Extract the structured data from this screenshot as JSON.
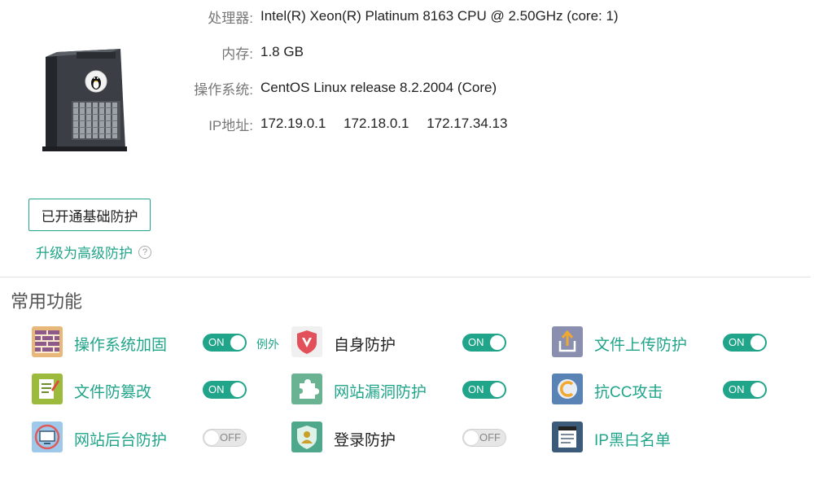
{
  "system_info": {
    "cpu_label": "处理器:",
    "cpu_value": "Intel(R) Xeon(R) Platinum 8163 CPU @ 2.50GHz (core: 1)",
    "memory_label": "内存:",
    "memory_value": "1.8 GB",
    "os_label": "操作系统:",
    "os_value": "CentOS Linux release 8.2.2004 (Core)",
    "ip_label": "IP地址:",
    "ips": [
      "172.19.0.1",
      "172.18.0.1",
      "172.17.34.13"
    ]
  },
  "protection": {
    "basic_button": "已开通基础防护",
    "upgrade_link": "升级为高级防护",
    "help_icon": "?"
  },
  "features": {
    "title": "常用功能",
    "on_text": "ON",
    "off_text": "OFF",
    "exception_link": "例外",
    "items": [
      {
        "label": "操作系统加固",
        "state": "on",
        "icon": "brick-wall-icon"
      },
      {
        "label": "自身防护",
        "state": "on",
        "icon": "shield-v-icon"
      },
      {
        "label": "文件上传防护",
        "state": "on",
        "icon": "upload-icon"
      },
      {
        "label": "文件防篡改",
        "state": "on",
        "icon": "file-edit-icon"
      },
      {
        "label": "网站漏洞防护",
        "state": "on",
        "icon": "puzzle-icon"
      },
      {
        "label": "抗CC攻击",
        "state": "on",
        "icon": "cc-shield-icon"
      },
      {
        "label": "网站后台防护",
        "state": "off",
        "icon": "monitor-icon"
      },
      {
        "label": "登录防护",
        "state": "off",
        "icon": "user-shield-icon"
      },
      {
        "label": "IP黑白名单",
        "state": "none",
        "icon": "list-icon"
      }
    ]
  },
  "colors": {
    "accent": "#20a58a",
    "toggle_off": "#e6e6e6"
  }
}
